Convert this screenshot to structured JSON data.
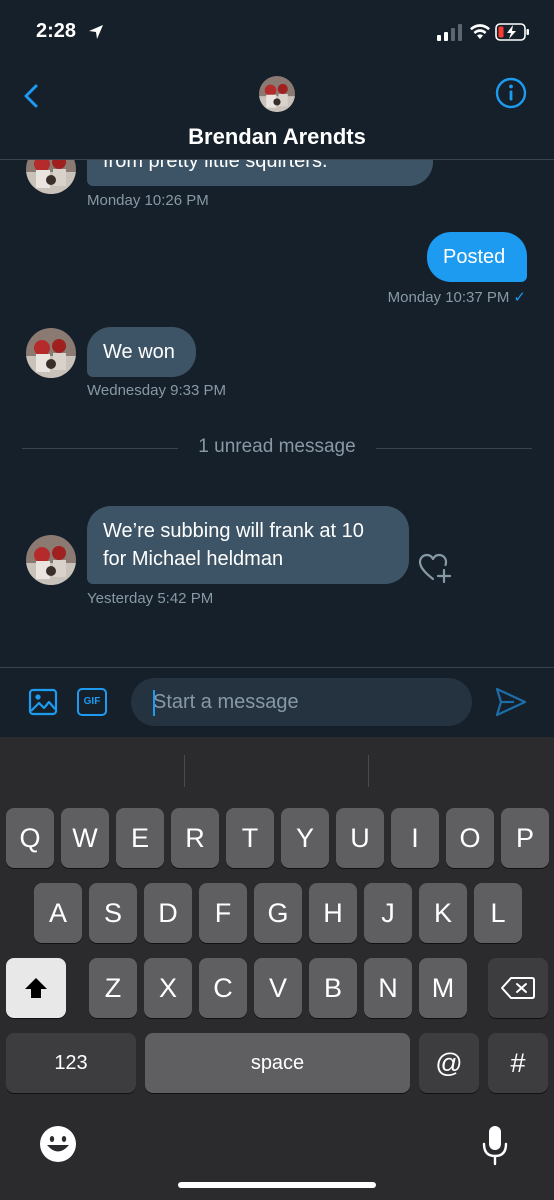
{
  "status_bar": {
    "time": "2:28"
  },
  "header": {
    "name": "Brendan Arendts"
  },
  "messages": {
    "m1_text": "from pretty little squirters.",
    "m1_time": "Monday 10:26 PM",
    "m2_text": "Posted",
    "m2_time": "Monday 10:37 PM",
    "m3_text": "We won",
    "m3_time": "Wednesday 9:33 PM",
    "unread_label": "1 unread message",
    "m4_line1": "We’re subbing will frank at 10",
    "m4_line2": "for Michael heldman",
    "m4_time": "Yesterday 5:42 PM"
  },
  "composer": {
    "placeholder": "Start a message",
    "gif_label": "GIF"
  },
  "keyboard": {
    "row1": [
      "Q",
      "W",
      "E",
      "R",
      "T",
      "Y",
      "U",
      "I",
      "O",
      "P"
    ],
    "row2": [
      "A",
      "S",
      "D",
      "F",
      "G",
      "H",
      "J",
      "K",
      "L"
    ],
    "row3": [
      "Z",
      "X",
      "C",
      "V",
      "B",
      "N",
      "M"
    ],
    "numbers_key": "123",
    "space_key": "space",
    "at_key": "@",
    "hash_key": "#"
  },
  "colors": {
    "accent": "#1d9bf0",
    "background": "#15202b",
    "incoming_bubble": "#3d5466"
  }
}
